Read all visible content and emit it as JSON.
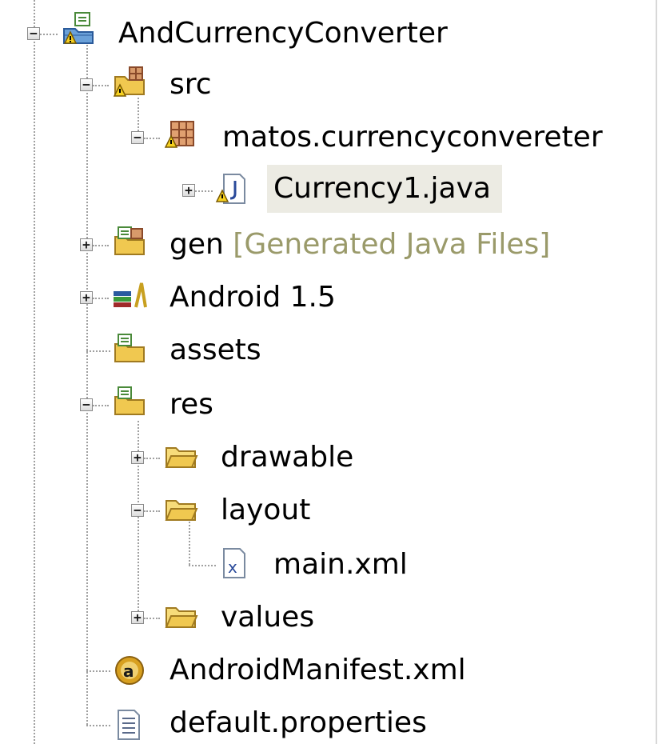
{
  "tree": {
    "nodes": [
      {
        "id": "root",
        "label": "AndCurrencyConverter",
        "decoration": "",
        "icon": "android-project-icon",
        "toggle": "−",
        "expanded": true,
        "selected": false
      },
      {
        "id": "src",
        "label": "src",
        "decoration": "",
        "icon": "source-folder-icon",
        "toggle": "−",
        "expanded": true,
        "selected": false
      },
      {
        "id": "package",
        "label": "matos.currencyconvereter",
        "decoration": "",
        "icon": "package-icon",
        "toggle": "−",
        "expanded": true,
        "selected": false
      },
      {
        "id": "currency1",
        "label": "Currency1.java",
        "decoration": "",
        "icon": "java-file-icon",
        "toggle": "+",
        "expanded": false,
        "selected": true
      },
      {
        "id": "gen",
        "label": "gen",
        "decoration": "[Generated Java Files]",
        "icon": "generated-folder-icon",
        "toggle": "+",
        "expanded": false,
        "selected": false
      },
      {
        "id": "android",
        "label": "Android 1.5",
        "decoration": "",
        "icon": "library-icon",
        "toggle": "+",
        "expanded": false,
        "selected": false
      },
      {
        "id": "assets",
        "label": "assets",
        "decoration": "",
        "icon": "resource-folder-icon",
        "toggle": "",
        "expanded": false,
        "selected": false
      },
      {
        "id": "res",
        "label": "res",
        "decoration": "",
        "icon": "resource-folder-icon",
        "toggle": "−",
        "expanded": true,
        "selected": false
      },
      {
        "id": "drawable",
        "label": "drawable",
        "decoration": "",
        "icon": "folder-icon",
        "toggle": "+",
        "expanded": false,
        "selected": false
      },
      {
        "id": "layout",
        "label": "layout",
        "decoration": "",
        "icon": "folder-icon",
        "toggle": "−",
        "expanded": true,
        "selected": false
      },
      {
        "id": "mainxml",
        "label": "main.xml",
        "decoration": "",
        "icon": "xml-file-icon",
        "toggle": "",
        "expanded": false,
        "selected": false
      },
      {
        "id": "values",
        "label": "values",
        "decoration": "",
        "icon": "folder-icon",
        "toggle": "+",
        "expanded": false,
        "selected": false
      },
      {
        "id": "manifest",
        "label": "AndroidManifest.xml",
        "decoration": "",
        "icon": "android-manifest-icon",
        "toggle": "",
        "expanded": false,
        "selected": false
      },
      {
        "id": "defaultprops",
        "label": "default.properties",
        "decoration": "",
        "icon": "properties-file-icon",
        "toggle": "",
        "expanded": false,
        "selected": false
      }
    ]
  },
  "colors": {
    "background": "#ffffff",
    "selection": "#ecebe3",
    "decoration_text": "#9a9a6a",
    "folder": "#f0c850",
    "tree_lines": "#a0a0a0"
  }
}
